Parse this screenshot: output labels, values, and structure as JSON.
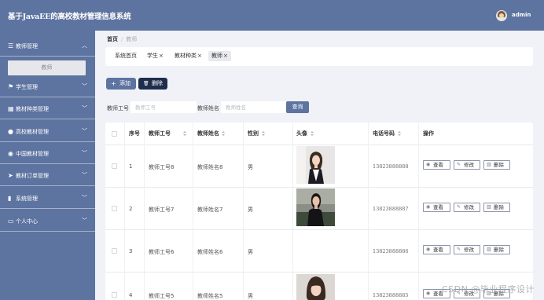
{
  "header": {
    "title": "基于JavaEE的高校教材管理信息系统",
    "username": "admin"
  },
  "sidebar": {
    "items": [
      {
        "label": "教师管理",
        "icon": "list-icon",
        "expanded": true
      },
      {
        "label": "学生管理",
        "icon": "flag-icon"
      },
      {
        "label": "教材种类管理",
        "icon": "grid-icon"
      },
      {
        "label": "高校教材管理",
        "icon": "user-icon"
      },
      {
        "label": "中国教材管理",
        "icon": "location-icon"
      },
      {
        "label": "教材订单管理",
        "icon": "send-icon"
      },
      {
        "label": "系统管理",
        "icon": "bar-chart-icon"
      },
      {
        "label": "个人中心",
        "icon": "id-card-icon"
      }
    ],
    "submenu_active": "教师"
  },
  "breadcrumb": {
    "home": "首页",
    "separator": "/",
    "current": "教师"
  },
  "tags": [
    {
      "label": "系统首页",
      "closable": false
    },
    {
      "label": "学生",
      "closable": true
    },
    {
      "label": "教材种类",
      "closable": true
    },
    {
      "label": "教师",
      "closable": true,
      "active": true
    }
  ],
  "tag_close": "×",
  "toolbar": {
    "add_label": "添加",
    "add_icon": "+",
    "delete_label": "删除",
    "delete_icon": "🗑"
  },
  "search": {
    "id_label": "教师工号",
    "id_placeholder": "教师工号",
    "name_label": "教师姓名",
    "name_placeholder": "教师姓名",
    "button_label": "查询"
  },
  "table": {
    "headers": {
      "index": "序号",
      "teacher_id": "教师工号",
      "teacher_name": "教师姓名",
      "gender": "性别",
      "avatar": "头像",
      "phone": "电话号码",
      "actions": "操作"
    },
    "action_labels": {
      "view": "查看",
      "edit": "修改",
      "delete": "删除"
    },
    "rows": [
      {
        "index": "1",
        "teacher_id": "教师工号8",
        "teacher_name": "教师姓名8",
        "gender": "男",
        "has_photo": true,
        "phone": "13823888888"
      },
      {
        "index": "2",
        "teacher_id": "教师工号7",
        "teacher_name": "教师姓名7",
        "gender": "男",
        "has_photo": true,
        "phone": "13823888887"
      },
      {
        "index": "3",
        "teacher_id": "教师工号6",
        "teacher_name": "教师姓名6",
        "gender": "男",
        "has_photo": false,
        "phone": "13823888886"
      },
      {
        "index": "4",
        "teacher_id": "教师工号5",
        "teacher_name": "教师姓名5",
        "gender": "男",
        "has_photo": true,
        "phone": "13823888885"
      }
    ]
  },
  "watermark": "CSDN @毕业程序设计",
  "colors": {
    "primary": "#5d73a0",
    "dark_button": "#1f2d4d",
    "page_bg": "#f0f2f7"
  }
}
